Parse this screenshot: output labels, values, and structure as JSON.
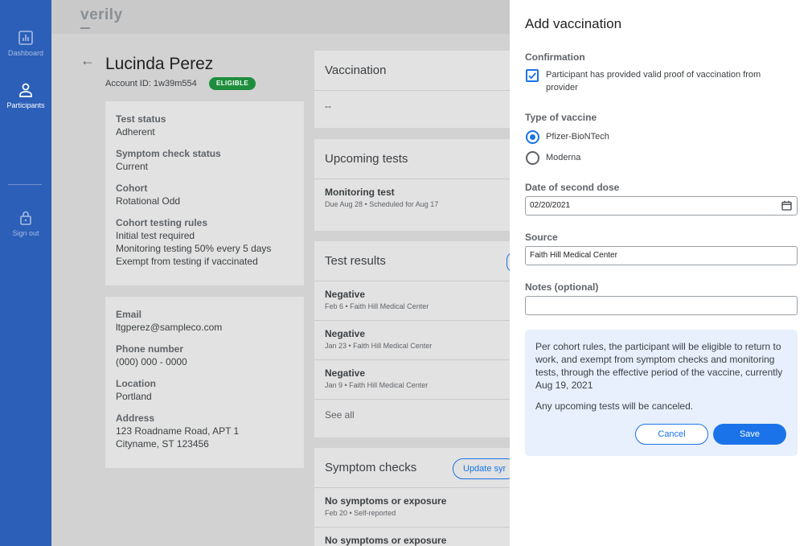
{
  "app": {
    "logo": "verily"
  },
  "sidebar": {
    "items": [
      {
        "label": "Dashboard",
        "icon": "bar-chart-icon"
      },
      {
        "label": "Participants",
        "icon": "person-icon"
      },
      {
        "label": "Sign out",
        "icon": "lock-icon"
      }
    ]
  },
  "patient": {
    "name": "Lucinda Perez",
    "account_id": "Account ID: 1w39m554",
    "badge": "ELIGIBLE",
    "status_fields": [
      {
        "label": "Test status",
        "value": "Adherent"
      },
      {
        "label": "Symptom check status",
        "value": "Current"
      },
      {
        "label": "Cohort",
        "value": "Rotational Odd"
      },
      {
        "label": "Cohort testing rules",
        "value": "Initial test required",
        "value2": "Monitoring testing 50% every 5 days",
        "value3": "Exempt from testing if vaccinated"
      }
    ],
    "contact_fields": [
      {
        "label": "Email",
        "value": "ltgperez@sampleco.com"
      },
      {
        "label": "Phone number",
        "value": "(000) 000 - 0000"
      },
      {
        "label": "Location",
        "value": "Portland"
      },
      {
        "label": "Address",
        "value": "123 Roadname Road, APT 1",
        "value2": "Cityname, ST 123456"
      }
    ]
  },
  "vaccination": {
    "title": "Vaccination",
    "value": "--"
  },
  "upcoming_tests": {
    "title": "Upcoming tests",
    "items": [
      {
        "title": "Monitoring test",
        "sub": "Due Aug 28 • Scheduled for Aug 17"
      }
    ]
  },
  "test_results": {
    "title": "Test results",
    "items": [
      {
        "title": "Negative",
        "sub": "Feb 6 • Faith Hill Medical Center"
      },
      {
        "title": "Negative",
        "sub": "Jan 23 • Faith Hill Medical Center"
      },
      {
        "title": "Negative",
        "sub": "Jan 9 • Faith Hill Medical Center"
      }
    ],
    "see_all": "See all"
  },
  "symptom_checks": {
    "title": "Symptom checks",
    "update_btn": "Update syr",
    "items": [
      {
        "title": "No symptoms or exposure",
        "sub": "Feb 20 • Self-reported"
      },
      {
        "title": "No symptoms or exposure",
        "sub": ""
      }
    ]
  },
  "panel": {
    "title": "Add vaccination",
    "confirmation_label": "Confirmation",
    "confirmation_text": "Participant has provided valid proof of vaccination from provider",
    "confirmation_checked": true,
    "vaccine_type_label": "Type of vaccine",
    "vaccine_options": [
      "Pfizer-BioNTech",
      "Moderna"
    ],
    "vaccine_selected": "Pfizer-BioNTech",
    "second_dose_label": "Date of second dose",
    "second_dose_value": "02/20/2021",
    "source_label": "Source",
    "source_value": "Faith Hill Medical Center",
    "notes_label": "Notes (optional)",
    "notes_value": "",
    "info_text": "Per cohort rules, the participant will be eligible to return to work, and exempt from symptom checks and monitoring tests, through the effective period of the vaccine, currently Aug 19, 2021",
    "info_text2": "Any upcoming tests will be canceled.",
    "cancel_label": "Cancel",
    "save_label": "Save"
  },
  "colors": {
    "sidebar": "#2b5fb8",
    "accent": "#1a73e8",
    "badge": "#1e8e3e",
    "info_box": "#e8f0fe"
  }
}
